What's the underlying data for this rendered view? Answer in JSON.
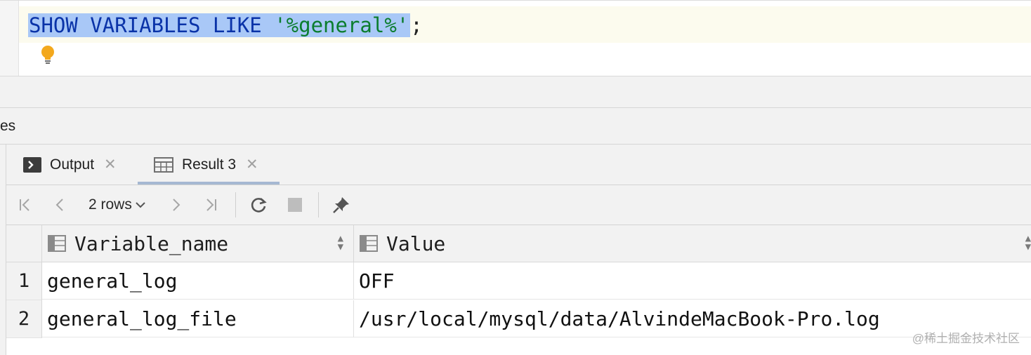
{
  "editor": {
    "keyword": "SHOW VARIABLES LIKE",
    "string": "'%general%'",
    "terminator": ";"
  },
  "services_label": "es",
  "tabs": [
    {
      "label": "Output",
      "icon": "console-icon"
    },
    {
      "label": "Result 3",
      "icon": "table-icon"
    }
  ],
  "toolbar": {
    "rows_label": "2 rows"
  },
  "grid": {
    "columns": [
      "Variable_name",
      "Value"
    ],
    "rows": [
      {
        "num": "1",
        "cells": [
          "general_log",
          "OFF"
        ]
      },
      {
        "num": "2",
        "cells": [
          "general_log_file",
          "/usr/local/mysql/data/AlvindeMacBook-Pro.log"
        ]
      }
    ]
  },
  "watermark": "@稀土掘金技术社区",
  "colors": {
    "selection": "#a9c8f7",
    "keyword": "#0a33a8",
    "string": "#0b7d2e",
    "tab_underline": "#a5b8d2",
    "bulb": "#f3a81c"
  }
}
